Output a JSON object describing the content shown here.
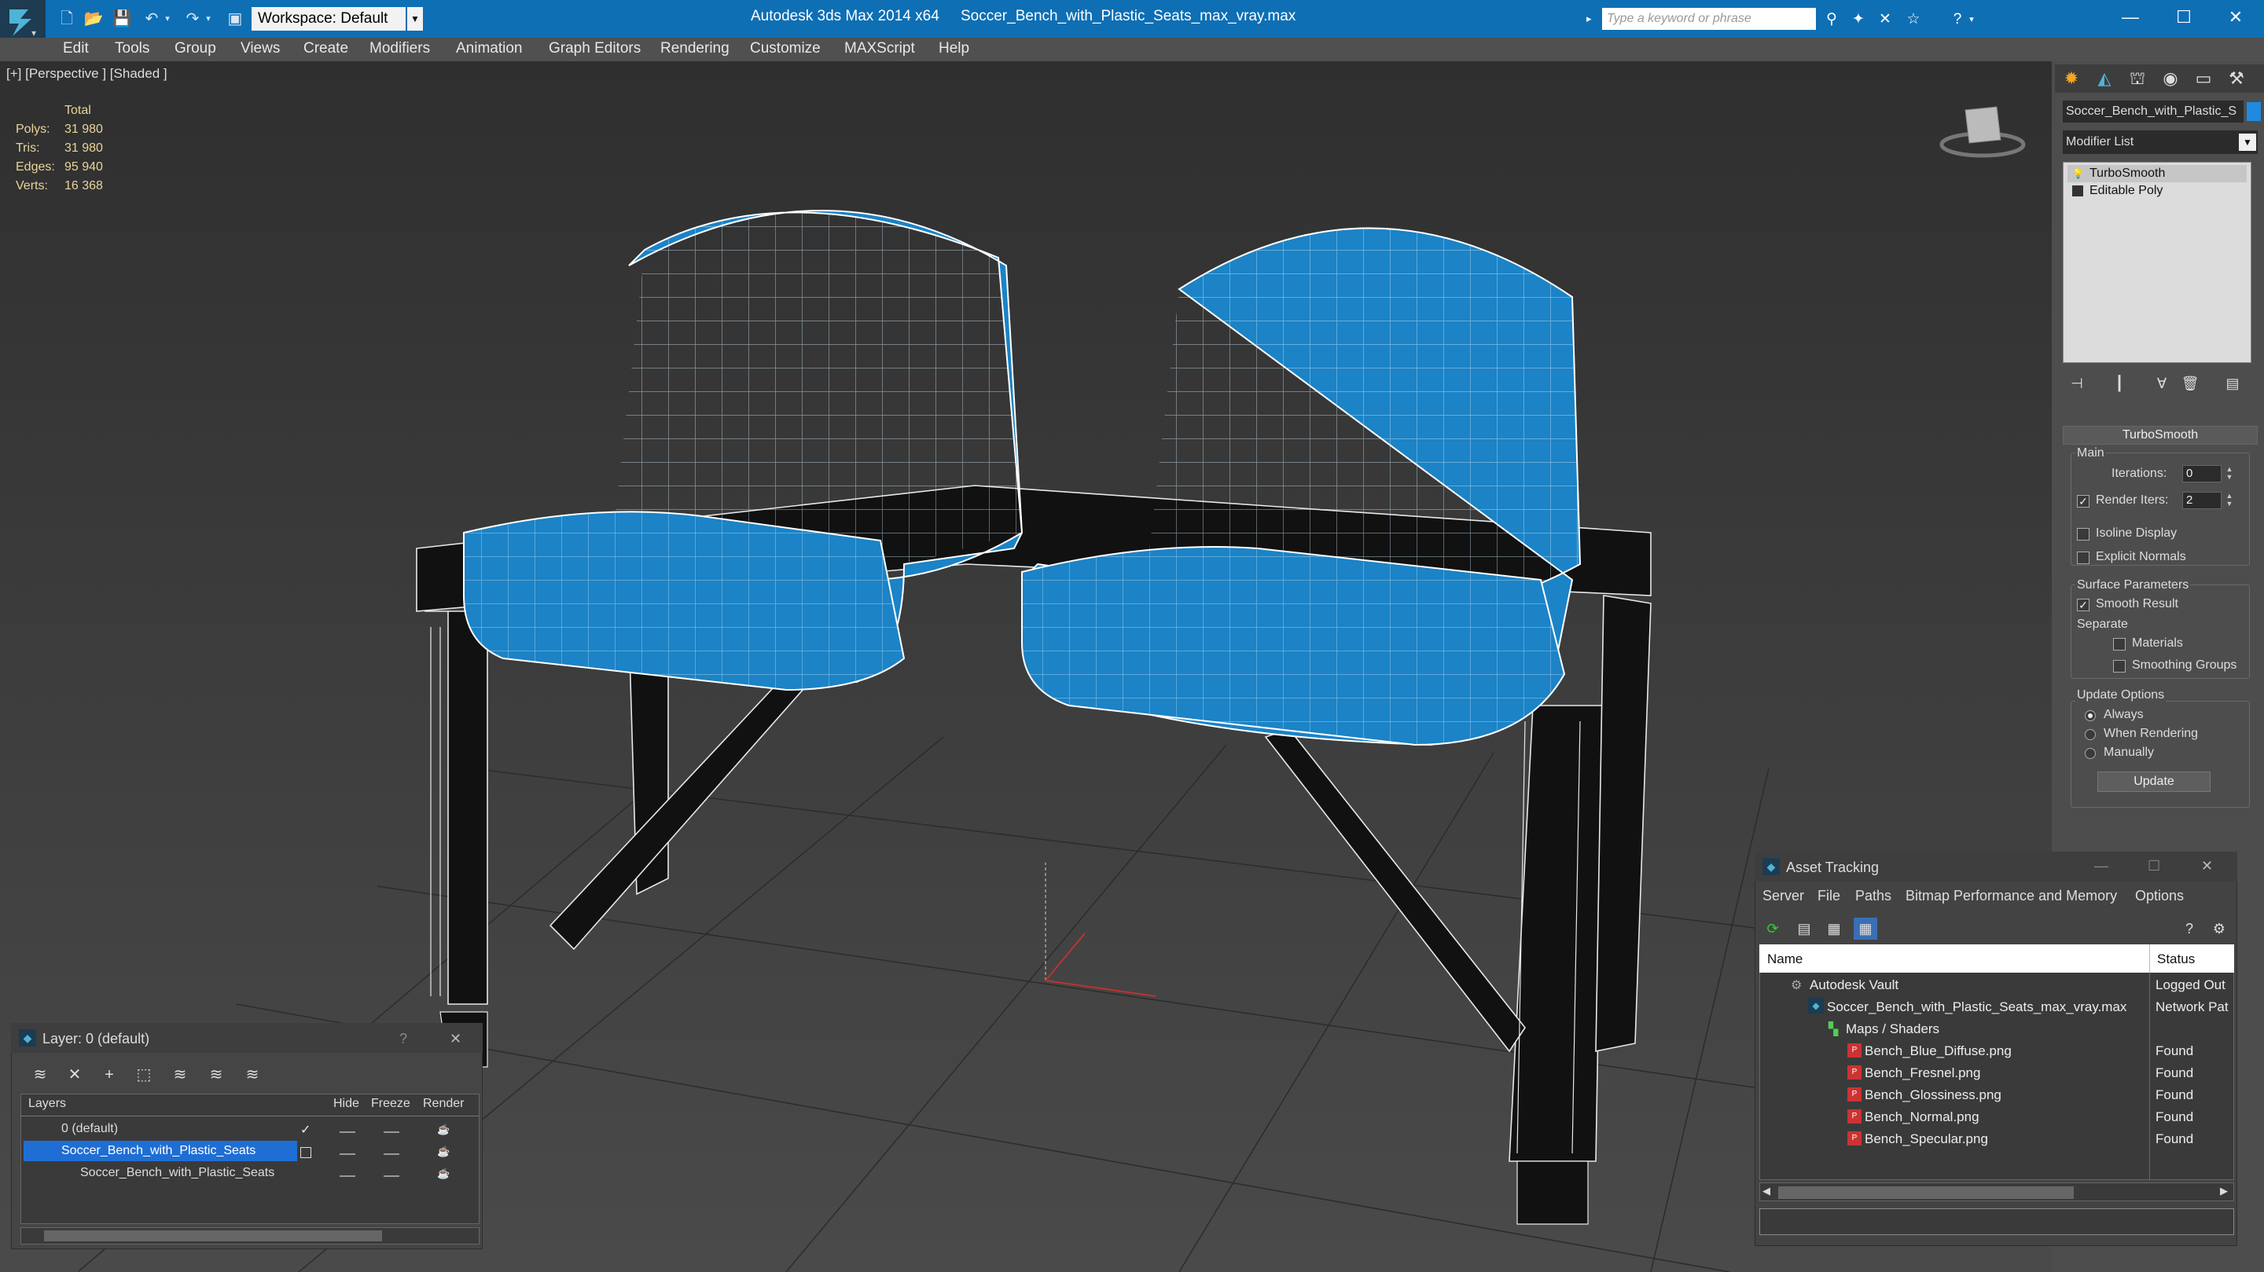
{
  "titlebar": {
    "workspace": "Workspace: Default",
    "app_title": "Autodesk 3ds Max  2014 x64",
    "file_title": "Soccer_Bench_with_Plastic_Seats_max_vray.max",
    "search_placeholder": "Type a keyword or phrase"
  },
  "menu": [
    "Edit",
    "Tools",
    "Group",
    "Views",
    "Create",
    "Modifiers",
    "Animation",
    "Graph Editors",
    "Rendering",
    "Customize",
    "MAXScript",
    "Help"
  ],
  "viewport": {
    "label": "[+] [Perspective ] [Shaded ]",
    "stats_header": "Total",
    "stats": [
      {
        "label": "Polys:",
        "value": "31 980"
      },
      {
        "label": "Tris:",
        "value": "31 980"
      },
      {
        "label": "Edges:",
        "value": "95 940"
      },
      {
        "label": "Verts:",
        "value": "16 368"
      }
    ],
    "seat_color": "#1b83c6",
    "wire_color": "#ffffff"
  },
  "command_panel": {
    "object_name": "Soccer_Bench_with_Plastic_S",
    "object_color": "#1f8ae0",
    "modifier_list": "Modifier List",
    "stack": [
      "TurboSmooth",
      "Editable Poly"
    ],
    "rollout_title": "TurboSmooth",
    "main_label": "Main",
    "iterations_label": "Iterations:",
    "iterations_value": "0",
    "render_iters_label": "Render Iters:",
    "render_iters_value": "2",
    "isoline": "Isoline Display",
    "explicit_normals": "Explicit Normals",
    "surface_params": "Surface Parameters",
    "smooth_result": "Smooth Result",
    "separate": "Separate",
    "materials": "Materials",
    "smoothing_groups": "Smoothing Groups",
    "update_options": "Update Options",
    "always": "Always",
    "when_rendering": "When Rendering",
    "manually": "Manually",
    "update_button": "Update"
  },
  "layer_dialog": {
    "title": "Layer: 0 (default)",
    "help": "?",
    "close": "✕",
    "columns": [
      "Layers",
      "Hide",
      "Freeze",
      "Render"
    ],
    "rows": [
      "0 (default)",
      "Soccer_Bench_with_Plastic_Seats",
      "Soccer_Bench_with_Plastic_Seats"
    ]
  },
  "asset_tracking": {
    "title": "Asset Tracking",
    "menu": [
      "Server",
      "File",
      "Paths",
      "Bitmap Performance and Memory",
      "Options"
    ],
    "col_name": "Name",
    "col_status": "Status",
    "rows": [
      {
        "name": "Autodesk Vault",
        "status": "Logged Out"
      },
      {
        "name": "Soccer_Bench_with_Plastic_Seats_max_vray.max",
        "status": "Network Pat"
      },
      {
        "name": "Maps / Shaders",
        "status": ""
      },
      {
        "name": "Bench_Blue_Diffuse.png",
        "status": "Found"
      },
      {
        "name": "Bench_Fresnel.png",
        "status": "Found"
      },
      {
        "name": "Bench_Glossiness.png",
        "status": "Found"
      },
      {
        "name": "Bench_Normal.png",
        "status": "Found"
      },
      {
        "name": "Bench_Specular.png",
        "status": "Found"
      }
    ]
  }
}
